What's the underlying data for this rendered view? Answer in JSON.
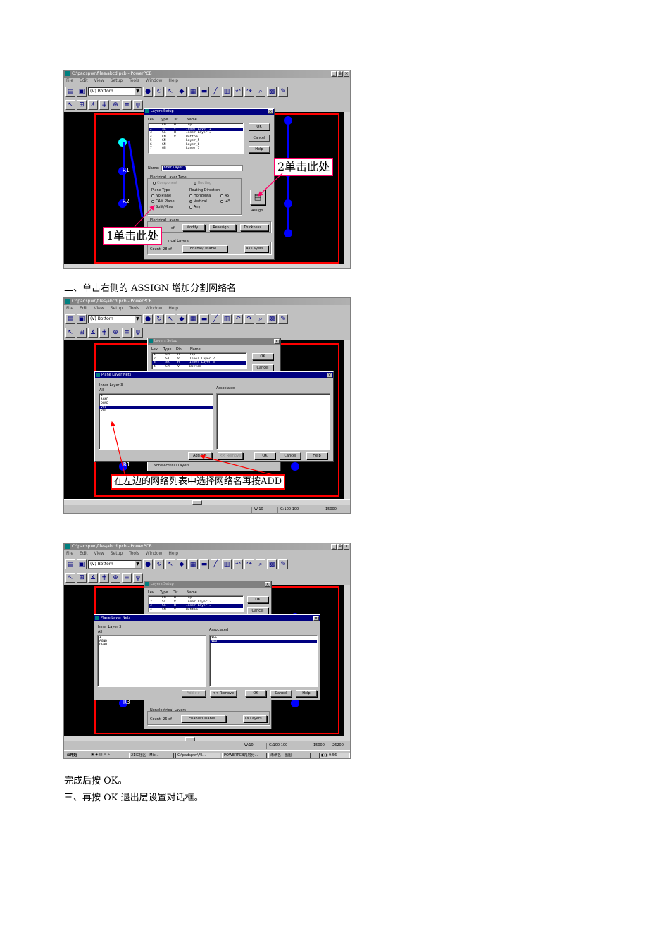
{
  "app": {
    "title": "C:\\padspwr\\files\\abcd.pcb - PowerPCB",
    "window_buttons": [
      "_",
      "ё",
      "×"
    ],
    "menu": [
      "File",
      "Edit",
      "View",
      "Setup",
      "Tools",
      "Window",
      "Help"
    ],
    "layer_selector": "(V) Bottom",
    "toolbar1_icons": [
      "open-icon",
      "save-icon",
      "info-icon",
      "refresh-icon",
      "select-icon",
      "route-icon",
      "zoom-icon",
      "pan-icon",
      "line-icon",
      "grid-icon",
      "undo-icon",
      "redo-icon",
      "find-icon",
      "layers-icon",
      "draft-icon"
    ],
    "toolbar2_icons": [
      "pointer-icon",
      "drafting-icon",
      "design-icon",
      "ecotool-icon",
      "bga-icon",
      "mode-icon",
      "vert-icon",
      "arrow-icon",
      "circle-icon",
      "rect-icon",
      "text-icon",
      "copper-icon",
      "cut-icon",
      "via-icon",
      "dim-icon",
      "pad-icon",
      "plane-icon",
      "pour-icon",
      "flood-icon"
    ]
  },
  "layers_setup": {
    "title": "Layers Setup",
    "headers": {
      "lev": "Lev.",
      "type": "Type",
      "dir": "Dir.",
      "name": "Name"
    },
    "rows": [
      {
        "lev": "1",
        "type": "CM",
        "dir": "H",
        "name": "Top"
      },
      {
        "lev": "2",
        "type": "SX",
        "dir": "V",
        "name": "Inner Layer 2"
      },
      {
        "lev": "3",
        "type": "SX",
        "dir": "H",
        "name": "Inner Layer 3"
      },
      {
        "lev": "4",
        "type": "CM",
        "dir": "V",
        "name": "Bottom"
      },
      {
        "lev": "5",
        "type": "GN",
        "dir": "",
        "name": "Layer_5"
      },
      {
        "lev": "6",
        "type": "GN",
        "dir": "",
        "name": "Layer_6"
      },
      {
        "lev": "7",
        "type": "GN",
        "dir": "",
        "name": "Layer_7"
      }
    ],
    "ok": "OK",
    "cancel": "Cancel",
    "help": "Help",
    "name_label": "Name:",
    "name_value": "Inner Layer 2",
    "electrical_layer_type": "Electrical Layer Type",
    "component": "Component",
    "routing": "Routing",
    "plane_type": "Plane Type",
    "no_plane": "No Plane",
    "cam_plane": "CAM Plane",
    "split_mixed": "Split/Mixe",
    "routing_direction": "Routing Direction",
    "horizontal": "Horizonta",
    "vertical": "Vertical",
    "any": "Any",
    "deg45": "45",
    "degm45": "-45",
    "assign": "Assign",
    "electrical_layers": "Electrical Layers",
    "count_of": "of",
    "modify": "Modify...",
    "reassign": "Reassign...",
    "thickness": "Thickness...",
    "nonelectrical_layers": "Nonelectrical Layers",
    "nonelectrical_partial": "rical Layers",
    "count": "Count: 28 of",
    "count_26": "Count: 26 of",
    "enable_disable": "Enable/Disable...",
    "max_layers": "ax Layers...",
    "max_layers_full": "ax Layers..."
  },
  "plane_nets": {
    "title": "Plane Layer Nets",
    "layer": "Inner Layer 3",
    "all": "All",
    "associated": "Associated",
    "nets_before": [
      "1",
      "AGND",
      "DGND",
      "VCC",
      "VDD"
    ],
    "selected_before": "VCC",
    "nets_after": [
      "1",
      "AGND",
      "DGND"
    ],
    "assoc_after": [
      "VCC",
      "VDD"
    ],
    "assoc_selected": "VDD",
    "add": "Add >>",
    "remove": "<< Remove",
    "ok": "OK",
    "cancel": "Cancel",
    "help": "Help"
  },
  "status": {
    "w": "W:10",
    "g": "G:100 100",
    "x": "15000",
    "y": "26200"
  },
  "taskbar": {
    "start": "开始",
    "items": [
      "21IC社区 - Mic...",
      "C:\\padspwr\\Fil...",
      "POWERPCB内层分...",
      "未命名 - 画图"
    ],
    "time": "9:56"
  },
  "pcb": {
    "r1": "R1",
    "r2": "R2",
    "r3": "R3"
  },
  "callouts": {
    "c1": "1单击此处",
    "c2": "2单击此处",
    "c3": "在左边的网络列表中选择网络名再按ADD"
  },
  "text": {
    "p1": "二、单击右侧的 ASSIGN 增加分割网络名",
    "p2": "完成后按 OK。",
    "p3": "三、再按 OK 退出层设置对话框。"
  },
  "colors": {
    "pcb_bg": "#000000",
    "board_outline": "#ff0000",
    "pad": "#0000ff",
    "callout_border": "#ff0066"
  }
}
